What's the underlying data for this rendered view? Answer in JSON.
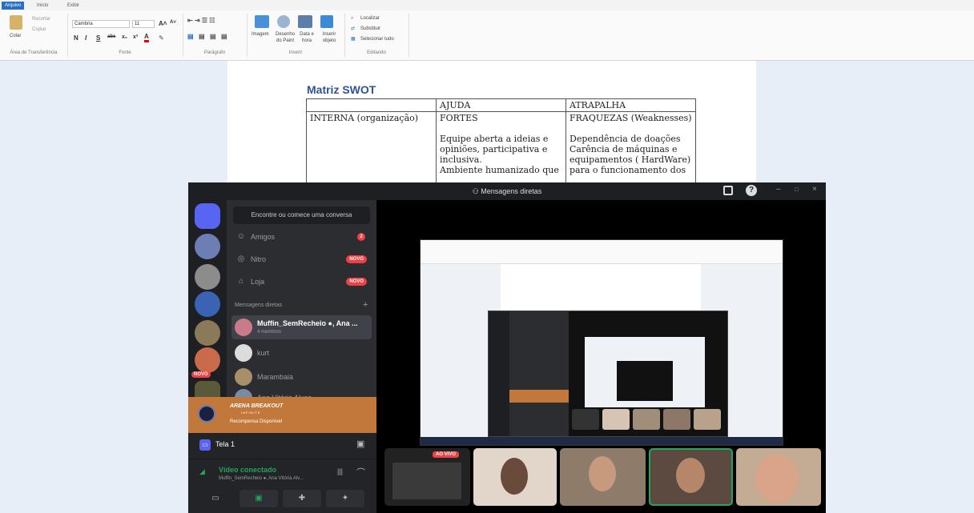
{
  "ribbon": {
    "tabs": [
      "Arquivo",
      "Início",
      "Exibir"
    ],
    "clipboard": {
      "paste": "Colar",
      "cut": "Recortar",
      "copy": "Copiar",
      "label": "Área de Transferência"
    },
    "font": {
      "name": "Cambria",
      "size": "11",
      "label": "Fonte"
    },
    "paragraph": {
      "label": "Parágrafo"
    },
    "insert": {
      "image": "Imagem",
      "paint": "Desenho do Paint",
      "datetime": "Data e hora",
      "object": "Inserir objeto",
      "label": "Inserir"
    },
    "editing": {
      "find": "Localizar",
      "replace": "Substituir",
      "select_all": "Selecionar tudo",
      "label": "Editando"
    }
  },
  "document": {
    "title": "Matriz SWOT",
    "table": {
      "header": [
        "",
        "AJUDA",
        "ATRAPALHA"
      ],
      "row_label": "INTERNA (organização)",
      "strengths_title": "FORTES",
      "weaknesses_title": "FRAQUEZAS (Weaknesses)",
      "strengths_lines": [
        "Equipe aberta a ideias e",
        "opiniões, participativa e",
        "inclusiva.",
        "Ambiente humanizado que"
      ],
      "weaknesses_lines": [
        "Dependência de doações",
        "Carência de máquinas e",
        "equipamentos ( HardWare)",
        "para o funcionamento dos"
      ]
    }
  },
  "discord": {
    "title": "Mensagens diretas",
    "search_placeholder": "Encontre ou comece uma conversa",
    "nav": [
      {
        "label": "Amigos",
        "icon": "friends-icon",
        "badge": "2"
      },
      {
        "label": "Nitro",
        "icon": "nitro-icon",
        "badge": "NOVO"
      },
      {
        "label": "Loja",
        "icon": "shop-icon",
        "badge": "NOVO"
      }
    ],
    "dm_header": "Mensagens diretas",
    "dms": [
      {
        "name": "Muffin_SemRecheio ●, Ana ...",
        "sub": "4 membros"
      },
      {
        "name": "kurt",
        "sub": ""
      },
      {
        "name": "Marambaia",
        "sub": ""
      },
      {
        "name": "Ana Vitória Alves",
        "sub": ""
      }
    ],
    "server_novo_badge": "NOVO",
    "promo": {
      "brand": "ARENA BREAKOUT",
      "subtitle": "INFINITE",
      "text": "Recompensa Disponível"
    },
    "screen_share": {
      "label": "Tela 1"
    },
    "voice": {
      "status": "Vídeo conectado",
      "channel": "Muffin_SemRecheio ●, Ana Vitória Alv..."
    },
    "live_badge": "AO VIVO",
    "colors": {
      "brand": "#5865f2",
      "connected": "#23a55a",
      "danger": "#f23f43",
      "promo": "#c3783b"
    }
  }
}
